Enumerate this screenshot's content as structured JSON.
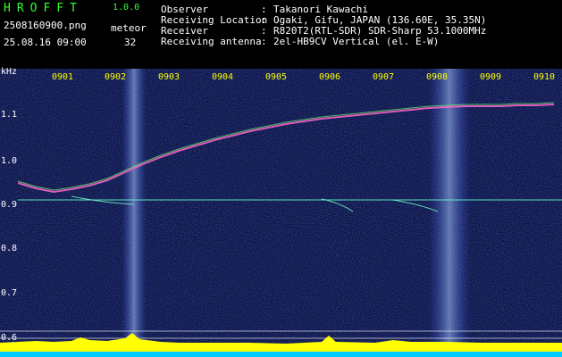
{
  "app": {
    "logo": "HROFFT",
    "version": "1.0.0"
  },
  "file": {
    "name": "2508160900.png",
    "datetime": "25.08.16 09:00"
  },
  "meteor": {
    "label": "meteor",
    "count": "32"
  },
  "metadata": [
    {
      "label": "Observer",
      "value": "Takanori Kawachi"
    },
    {
      "label": "Receiving Location",
      "value": "Ogaki, Gifu, JAPAN (136.60E, 35.35N)"
    },
    {
      "label": "Receiver",
      "value": "R820T2(RTL-SDR) SDR-Sharp 53.1000MHz"
    },
    {
      "label": "Receiving antenna",
      "value": "2el-HB9CV Vertical (el. E-W)"
    }
  ],
  "axis": {
    "unit": "kHz",
    "time_ticks": [
      "0901",
      "0902",
      "0903",
      "0904",
      "0905",
      "0906",
      "0907",
      "0908",
      "0909",
      "0910"
    ],
    "freq_ticks": [
      "1.1",
      "1.0",
      "0.9",
      "0.8",
      "0.7",
      "0.6"
    ]
  },
  "colors": {
    "background": "#000000",
    "spectrogram": "#0a0f3a",
    "header_text": "#ffffff",
    "logo": "#33ff33",
    "time_ticks": "#ffff00",
    "power_trace": "#ffff00",
    "power_baseline": "#00ccff",
    "carrier": "#66ffcc"
  }
}
